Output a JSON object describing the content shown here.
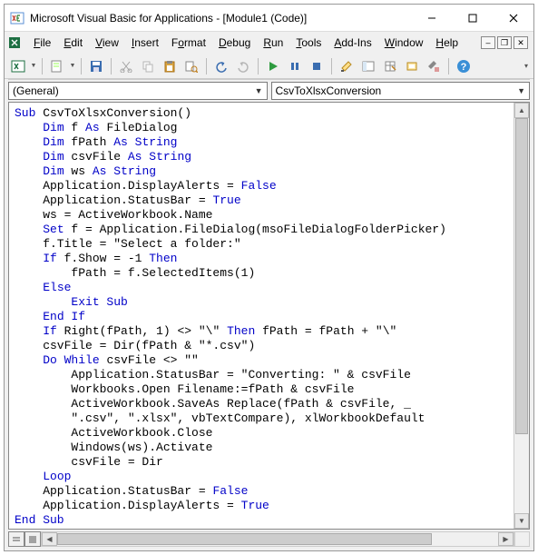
{
  "title": "Microsoft Visual Basic for Applications - [Module1 (Code)]",
  "menu": {
    "file": "File",
    "edit": "Edit",
    "view": "View",
    "insert": "Insert",
    "format": "Format",
    "debug": "Debug",
    "run": "Run",
    "tools": "Tools",
    "addins": "Add-Ins",
    "window": "Window",
    "help": "Help"
  },
  "combos": {
    "object": "(General)",
    "procedure": "CsvToXlsxConversion"
  },
  "code_tokens": [
    [
      [
        "kw",
        "Sub"
      ],
      [
        "",
        " CsvToXlsxConversion()"
      ]
    ],
    [
      [
        "",
        "    "
      ],
      [
        "kw",
        "Dim"
      ],
      [
        "",
        " f "
      ],
      [
        "kw",
        "As"
      ],
      [
        "",
        " FileDialog"
      ]
    ],
    [
      [
        "",
        "    "
      ],
      [
        "kw",
        "Dim"
      ],
      [
        "",
        " fPath "
      ],
      [
        "kw",
        "As"
      ],
      [
        "",
        " "
      ],
      [
        "kw",
        "String"
      ]
    ],
    [
      [
        "",
        "    "
      ],
      [
        "kw",
        "Dim"
      ],
      [
        "",
        " csvFile "
      ],
      [
        "kw",
        "As"
      ],
      [
        "",
        " "
      ],
      [
        "kw",
        "String"
      ]
    ],
    [
      [
        "",
        "    "
      ],
      [
        "kw",
        "Dim"
      ],
      [
        "",
        " ws "
      ],
      [
        "kw",
        "As"
      ],
      [
        "",
        " "
      ],
      [
        "kw",
        "String"
      ]
    ],
    [
      [
        "",
        "    Application.DisplayAlerts = "
      ],
      [
        "kw",
        "False"
      ]
    ],
    [
      [
        "",
        "    Application.StatusBar = "
      ],
      [
        "kw",
        "True"
      ]
    ],
    [
      [
        "",
        "    ws = ActiveWorkbook.Name"
      ]
    ],
    [
      [
        "",
        "    "
      ],
      [
        "kw",
        "Set"
      ],
      [
        "",
        " f = Application.FileDialog(msoFileDialogFolderPicker)"
      ]
    ],
    [
      [
        "",
        "    f.Title = \"Select a folder:\""
      ]
    ],
    [
      [
        "",
        "    "
      ],
      [
        "kw",
        "If"
      ],
      [
        "",
        " f.Show = -1 "
      ],
      [
        "kw",
        "Then"
      ]
    ],
    [
      [
        "",
        "        fPath = f.SelectedItems(1)"
      ]
    ],
    [
      [
        "",
        "    "
      ],
      [
        "kw",
        "Else"
      ]
    ],
    [
      [
        "",
        "        "
      ],
      [
        "kw",
        "Exit Sub"
      ]
    ],
    [
      [
        "",
        "    "
      ],
      [
        "kw",
        "End If"
      ]
    ],
    [
      [
        "",
        "    "
      ],
      [
        "kw",
        "If"
      ],
      [
        "",
        " Right(fPath, 1) <> \"\\\" "
      ],
      [
        "kw",
        "Then"
      ],
      [
        "",
        " fPath = fPath + \"\\\""
      ]
    ],
    [
      [
        "",
        "    csvFile = Dir(fPath & \"*.csv\")"
      ]
    ],
    [
      [
        "",
        "    "
      ],
      [
        "kw",
        "Do While"
      ],
      [
        "",
        " csvFile <> \"\""
      ]
    ],
    [
      [
        "",
        "        Application.StatusBar = \"Converting: \" & csvFile"
      ]
    ],
    [
      [
        "",
        "        Workbooks.Open Filename:=fPath & csvFile"
      ]
    ],
    [
      [
        "",
        "        ActiveWorkbook.SaveAs Replace(fPath & csvFile, _"
      ]
    ],
    [
      [
        "",
        "        \".csv\", \".xlsx\", vbTextCompare), xlWorkbookDefault"
      ]
    ],
    [
      [
        "",
        "        ActiveWorkbook.Close"
      ]
    ],
    [
      [
        "",
        "        Windows(ws).Activate"
      ]
    ],
    [
      [
        "",
        "        csvFile = Dir"
      ]
    ],
    [
      [
        "",
        "    "
      ],
      [
        "kw",
        "Loop"
      ]
    ],
    [
      [
        "",
        "    Application.StatusBar = "
      ],
      [
        "kw",
        "False"
      ]
    ],
    [
      [
        "",
        "    Application.DisplayAlerts = "
      ],
      [
        "kw",
        "True"
      ]
    ],
    [
      [
        "kw",
        "End Sub"
      ]
    ]
  ]
}
